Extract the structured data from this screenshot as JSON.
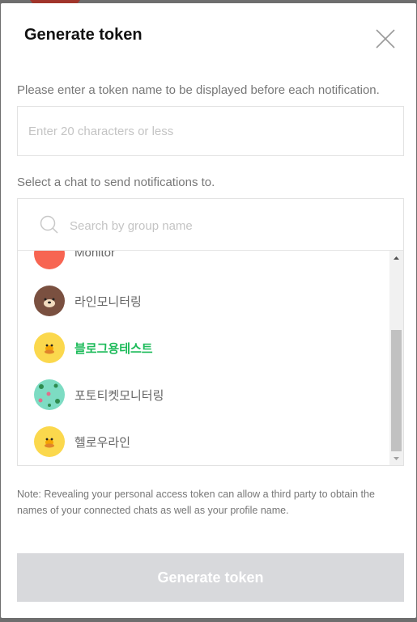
{
  "dialog": {
    "title": "Generate token",
    "close_icon": "close-icon"
  },
  "token_name": {
    "label": "Please enter a token name to be displayed before each notification.",
    "placeholder": "Enter 20 characters or less",
    "value": ""
  },
  "chat_select": {
    "label": "Select a chat to send notifications to.",
    "search_placeholder": "Search by group name",
    "search_icon": "search-icon",
    "items": [
      {
        "label": "Monitor",
        "avatar": "red-avatar",
        "avatar_color": "#f76552",
        "selected": false
      },
      {
        "label": "라인모니터링",
        "avatar": "brown-bear-avatar",
        "avatar_color": "#7a5040",
        "selected": false
      },
      {
        "label": "블로그용테스트",
        "avatar": "sally-chick-avatar",
        "avatar_color": "#fbd84d",
        "selected": true
      },
      {
        "label": "포토티켓모니터링",
        "avatar": "patterned-avatar",
        "avatar_color": "#7ddcc3",
        "selected": false
      },
      {
        "label": "헬로우라인",
        "avatar": "sally-chick-avatar",
        "avatar_color": "#fbd84d",
        "selected": false
      }
    ]
  },
  "note": "Note: Revealing your personal access token can allow a third party to obtain the names of your connected chats as well as your profile name.",
  "generate_button": {
    "label": "Generate token",
    "enabled": false
  },
  "colors": {
    "selected_text": "#1dbb5a",
    "button_disabled_bg": "#d8d9dc",
    "overlay": "#6e6e6e"
  }
}
